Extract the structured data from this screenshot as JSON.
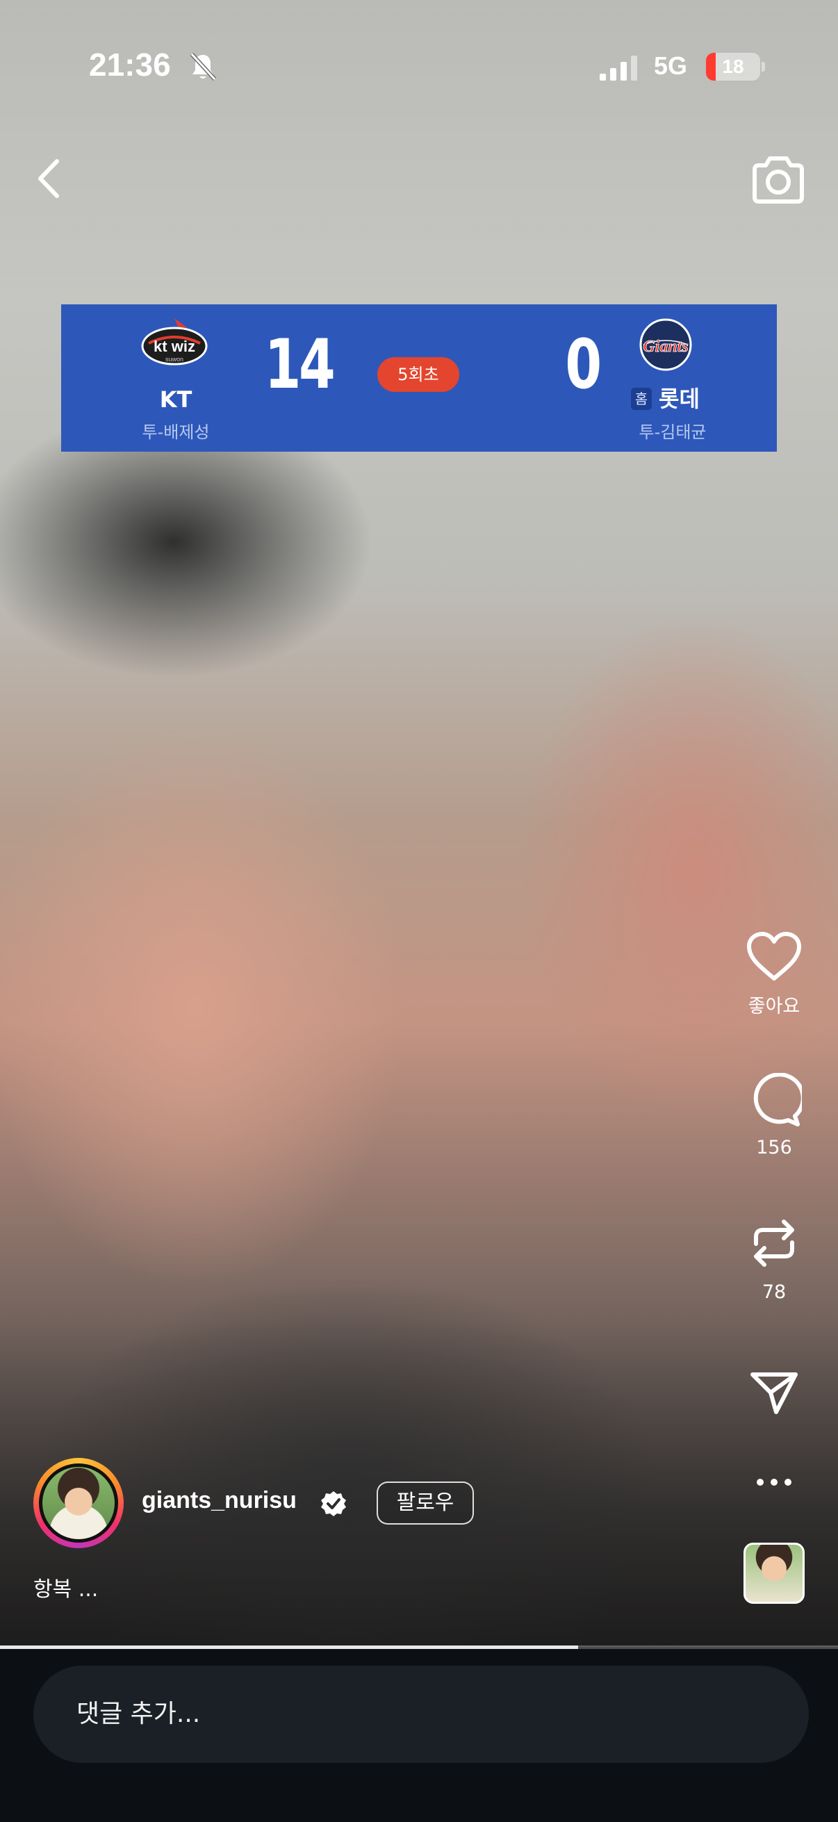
{
  "status_bar": {
    "time": "21:36",
    "network": "5G",
    "battery": "18",
    "battery_fraction": 0.18
  },
  "header": {
    "back_icon": "chevron-left-icon",
    "camera_icon": "camera-icon"
  },
  "scoreboard": {
    "away_team": "KT",
    "away_pitcher": "투-배제성",
    "away_score": "14",
    "inning": "5회초",
    "home_badge": "홈",
    "home_team": "롯데",
    "home_pitcher": "투-김태균",
    "home_score": "0",
    "background": "#2d58ba",
    "inning_color": "#e4452e"
  },
  "actions": {
    "like_label": "좋아요",
    "comment_count": "156",
    "repost_count": "78"
  },
  "post": {
    "username": "giants_nurisu",
    "follow_label": "팔로우",
    "caption": "항복 ..."
  },
  "playback": {
    "progress": 0.69
  },
  "comment_bar": {
    "placeholder": "댓글 추가..."
  }
}
